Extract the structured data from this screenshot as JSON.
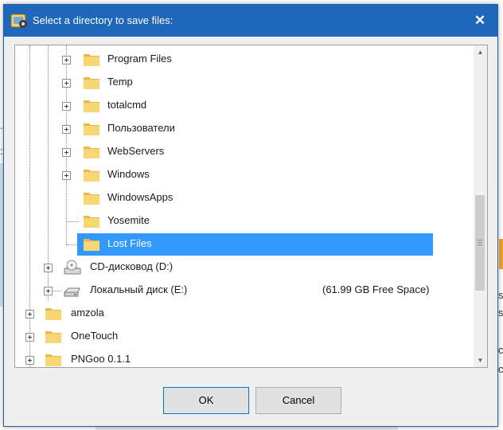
{
  "dialog": {
    "title": "Select a directory to save files:",
    "close_glyph": "✕"
  },
  "tree": {
    "nodes": [
      {
        "label": "Program Files",
        "icon": "folder-icon",
        "expandable": true
      },
      {
        "label": "Temp",
        "icon": "folder-icon",
        "expandable": true
      },
      {
        "label": "totalcmd",
        "icon": "folder-icon",
        "expandable": true
      },
      {
        "label": "Пользователи",
        "icon": "folder-icon",
        "expandable": true
      },
      {
        "label": "WebServers",
        "icon": "folder-icon",
        "expandable": true
      },
      {
        "label": "Windows",
        "icon": "folder-icon",
        "expandable": true
      },
      {
        "label": "WindowsApps",
        "icon": "folder-icon",
        "expandable": false
      },
      {
        "label": "Yosemite",
        "icon": "folder-icon",
        "expandable": false
      },
      {
        "label": "Lost Files",
        "icon": "folder-icon",
        "expandable": false,
        "selected": true
      },
      {
        "label": "CD-дисковод (D:)",
        "icon": "cd-drive-icon",
        "expandable": true
      },
      {
        "label": "Локальный диск (E:)",
        "icon": "hard-drive-icon",
        "expandable": true,
        "free_space": "(61.99 GB Free Space)"
      },
      {
        "label": "amzola",
        "icon": "folder-icon",
        "expandable": true
      },
      {
        "label": "OneTouch",
        "icon": "folder-icon",
        "expandable": true
      },
      {
        "label": "PNGoo 0.1.1",
        "icon": "folder-icon",
        "expandable": true
      }
    ]
  },
  "buttons": {
    "ok_label": "OK",
    "cancel_label": "Cancel"
  },
  "background": {
    "left_chars": [
      ".",
      ":"
    ],
    "right_chars": [
      "s",
      "s",
      "c",
      "c"
    ]
  },
  "colors": {
    "titlebar": "#1f67b8",
    "selection": "#3399ff"
  }
}
